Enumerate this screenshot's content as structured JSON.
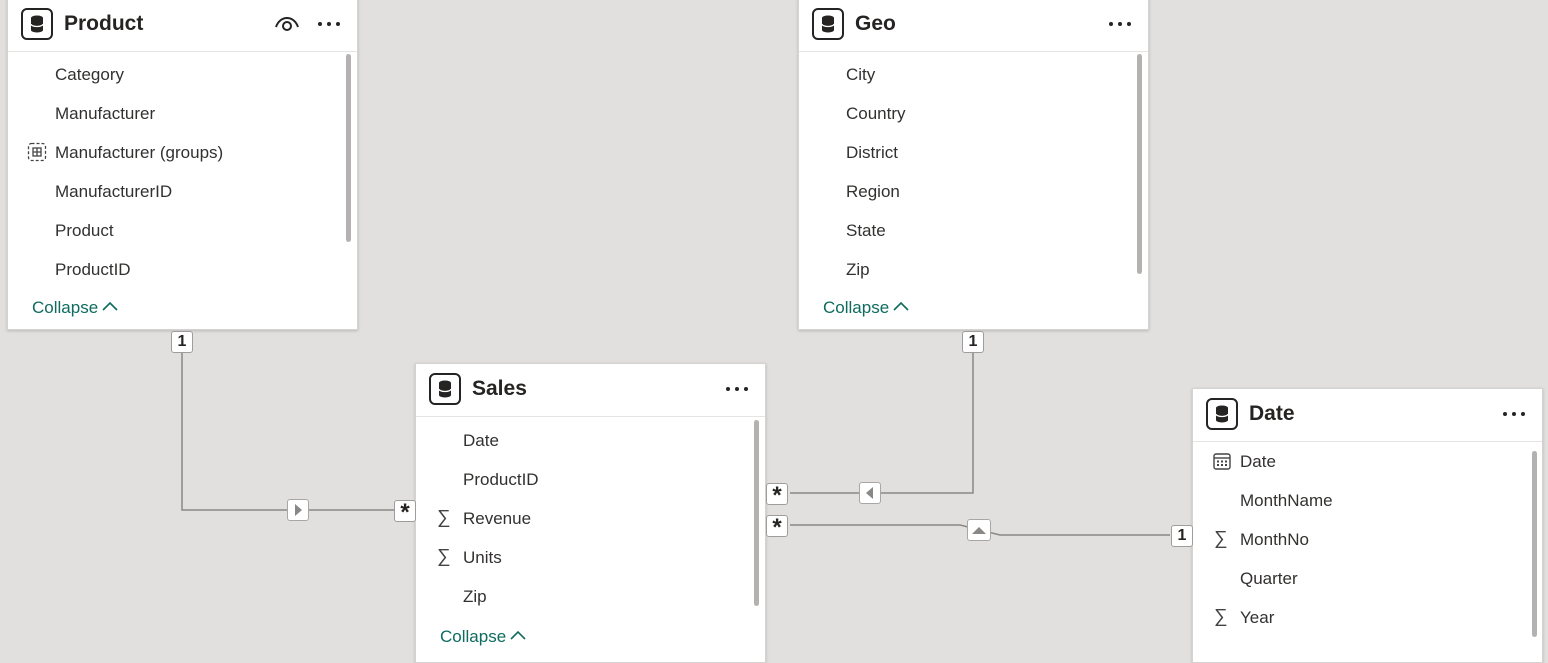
{
  "colors": {
    "canvas": "#e1e0df",
    "accent_link": "#0e6b5e",
    "relationship_line": "#8a8886"
  },
  "tables": {
    "product": {
      "title": "Product",
      "fields": [
        {
          "label": "Category",
          "icon": ""
        },
        {
          "label": "Manufacturer",
          "icon": ""
        },
        {
          "label": "Manufacturer (groups)",
          "icon": "group-icon"
        },
        {
          "label": "ManufacturerID",
          "icon": ""
        },
        {
          "label": "Product",
          "icon": ""
        },
        {
          "label": "ProductID",
          "icon": ""
        }
      ],
      "collapse_label": "Collapse"
    },
    "geo": {
      "title": "Geo",
      "fields": [
        {
          "label": "City",
          "icon": ""
        },
        {
          "label": "Country",
          "icon": ""
        },
        {
          "label": "District",
          "icon": ""
        },
        {
          "label": "Region",
          "icon": ""
        },
        {
          "label": "State",
          "icon": ""
        },
        {
          "label": "Zip",
          "icon": ""
        }
      ],
      "collapse_label": "Collapse"
    },
    "sales": {
      "title": "Sales",
      "fields": [
        {
          "label": "Date",
          "icon": ""
        },
        {
          "label": "ProductID",
          "icon": ""
        },
        {
          "label": "Revenue",
          "icon": "sigma-icon"
        },
        {
          "label": "Units",
          "icon": "sigma-icon"
        },
        {
          "label": "Zip",
          "icon": ""
        }
      ],
      "collapse_label": "Collapse"
    },
    "date": {
      "title": "Date",
      "fields": [
        {
          "label": "Date",
          "icon": "calendar-icon"
        },
        {
          "label": "MonthName",
          "icon": ""
        },
        {
          "label": "MonthNo",
          "icon": "sigma-icon"
        },
        {
          "label": "Quarter",
          "icon": ""
        },
        {
          "label": "Year",
          "icon": "sigma-icon"
        }
      ]
    }
  },
  "relationships": {
    "product_sales": {
      "one": "1",
      "many": "*"
    },
    "geo_sales": {
      "one": "1",
      "many": "*"
    },
    "date_sales": {
      "one": "1",
      "many": "*"
    }
  },
  "glyphs": {
    "sigma": "∑"
  }
}
